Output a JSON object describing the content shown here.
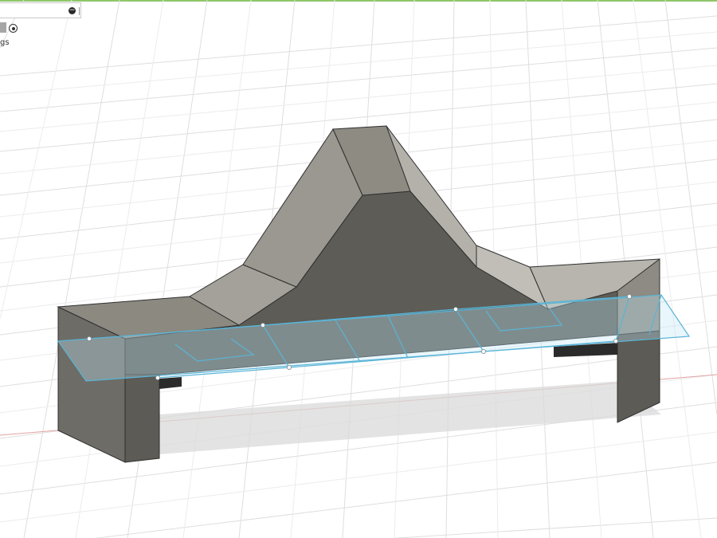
{
  "viewport": {
    "description_hidden": "",
    "colors": {
      "background": "#ffffff",
      "grid": "#dcdcdc",
      "axis_red": "#e08a8a",
      "body_front": "#5f5e58",
      "body_top": "#8a887f",
      "body_light": "#b0aea6",
      "body_side": "#73716a",
      "section_plane": "#5ab4d6"
    }
  },
  "browser_panel": {
    "collapse_icon": "minus-circle-icon",
    "radio_icon": "radio-selected-icon",
    "partial_label": "gs"
  }
}
